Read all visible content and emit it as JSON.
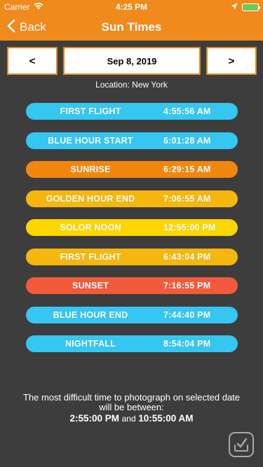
{
  "status": {
    "carrier": "Carrier",
    "time": "4:25 PM",
    "battery_color": "#4cd964"
  },
  "nav": {
    "back_label": "Back",
    "title": "Sun Times",
    "bar_color": "#f08a1c"
  },
  "date_picker": {
    "prev_label": "<",
    "date": "Sep 8, 2019",
    "next_label": ">"
  },
  "location": "Location: New York",
  "times": [
    {
      "label": "FIRST FLIGHT",
      "time": "4:55:56 AM",
      "color": "#35c6f2"
    },
    {
      "label": "BLUE HOUR START",
      "time": "6:01:28 AM",
      "color": "#35c6f2"
    },
    {
      "label": "SUNRISE",
      "time": "6:29:15 AM",
      "color": "#f2870f"
    },
    {
      "label": "GOLDEN HOUR END",
      "time": "7:06:55 AM",
      "color": "#f5b70d"
    },
    {
      "label": "SOLOR NOON",
      "time": "12:55:00 PM",
      "color": "#fbd600"
    },
    {
      "label": "FIRST FLIGHT",
      "time": "6:43:04 PM",
      "color": "#f5b70d"
    },
    {
      "label": "SUNSET",
      "time": "7:16:55 PM",
      "color": "#f35a3c"
    },
    {
      "label": "BLUE HOUR END",
      "time": "7:44:40 PM",
      "color": "#35c6f2"
    },
    {
      "label": "NIGHTFALL",
      "time": "8:54:04 PM",
      "color": "#35c6f2"
    }
  ],
  "footer": {
    "line1": "The most difficult time to photograph on selected date",
    "line2": "will be between:",
    "start": "2:55:00 PM",
    "and": "and",
    "end": "10:55:00 AM"
  },
  "icons": {
    "signal": "wifi-icon",
    "location": "location-arrow-icon",
    "back": "chevron-left-icon",
    "app": "checkmark-tray-icon"
  }
}
